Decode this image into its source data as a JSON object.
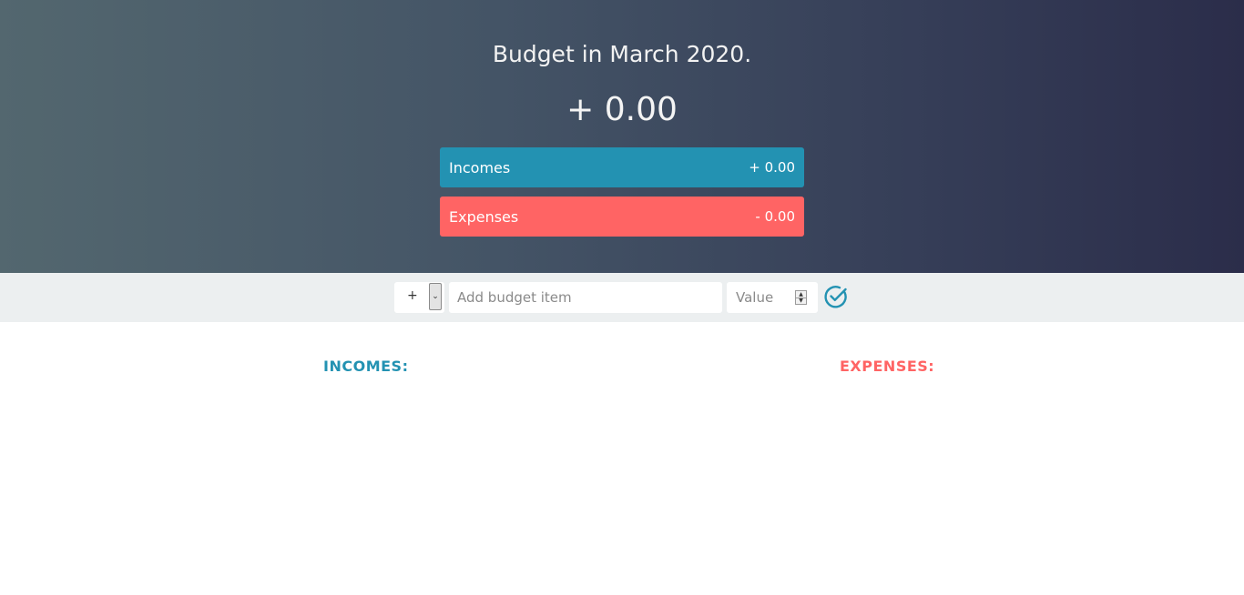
{
  "header": {
    "title": "Budget in March 2020.",
    "total": "+ 0.00"
  },
  "summary": {
    "income": {
      "label": "Incomes",
      "value": "+ 0.00",
      "color": "#2392b2"
    },
    "expense": {
      "label": "Expenses",
      "value": "- 0.00",
      "color": "#ff6464"
    }
  },
  "add_form": {
    "type_selected": "+",
    "description_placeholder": "Add budget item",
    "value_placeholder": "Value",
    "submit_icon": "check-circle-icon"
  },
  "lists": {
    "income_title": "INCOMES:",
    "expense_title": "EXPENSES:"
  }
}
